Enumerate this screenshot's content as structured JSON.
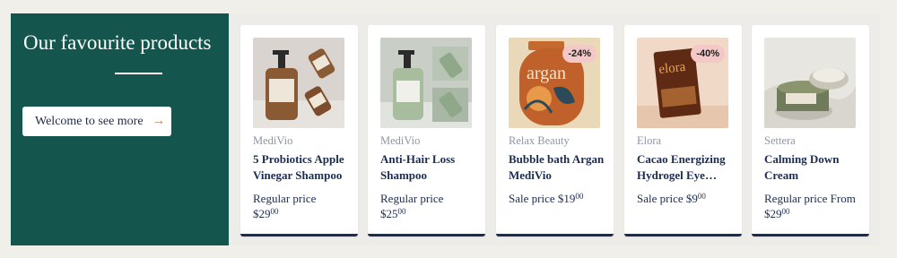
{
  "promo": {
    "title": "Our favourite products",
    "button_label": "Welcome to see more",
    "button_arrow": "→",
    "background": "#14564e"
  },
  "products": [
    {
      "brand": "MediVio",
      "name": "5 Probiotics Apple Vinegar Shampoo",
      "price_label": "Regular price",
      "currency": "$",
      "price_whole": "29",
      "price_cents": "00",
      "badge": "",
      "image_icon": "shampoo-bottles-image"
    },
    {
      "brand": "MediVio",
      "name": "Anti-Hair Loss Shampoo",
      "price_label": "Regular price",
      "currency": "$",
      "price_whole": "25",
      "price_cents": "00",
      "badge": "",
      "image_icon": "shampoo-bottles-image"
    },
    {
      "brand": "Relax Beauty",
      "name": "Bubble bath Argan MediVio",
      "price_label": "Sale price",
      "currency": "$",
      "price_whole": "19",
      "price_cents": "00",
      "badge": "-24%",
      "image_icon": "argan-pouch-image",
      "image_text": "argan"
    },
    {
      "brand": "Elora",
      "name": "Cacao Energizing Hydrogel Eye…",
      "price_label": "Sale price",
      "currency": "$",
      "price_whole": "9",
      "price_cents": "00",
      "badge": "-40%",
      "image_icon": "eye-patch-pouch-image",
      "image_text": "elora"
    },
    {
      "brand": "Settera",
      "name": "Calming Down Cream",
      "price_label": "Regular price From",
      "currency": "$",
      "price_whole": "29",
      "price_cents": "00",
      "badge": "",
      "image_icon": "cream-jar-image"
    }
  ],
  "colors": {
    "navy": "#1b2c52",
    "brand_gray": "#8e95a4",
    "badge_pink": "#f4c8c6"
  }
}
